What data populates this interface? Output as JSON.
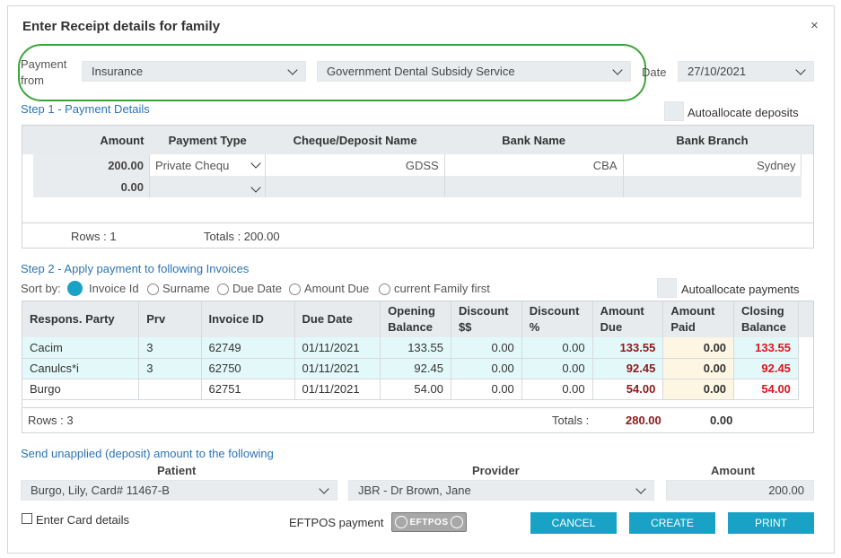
{
  "dialog": {
    "title": "Enter Receipt details for family",
    "close_icon": "×"
  },
  "payment_from": {
    "label_line1": "Payment",
    "label_line2": "from",
    "type_value": "Insurance",
    "provider_value": "Government Dental Subsidy Service"
  },
  "date": {
    "label": "Date",
    "value": "27/10/2021"
  },
  "step1": {
    "title": "Step 1 - Payment Details",
    "autoallocate_label": "Autoallocate deposits",
    "columns": [
      "Amount",
      "Payment Type",
      "Cheque/Deposit Name",
      "Bank Name",
      "Bank Branch"
    ],
    "row1": {
      "amount": "200.00",
      "type": "Private Chequ",
      "name": "GDSS",
      "bank": "CBA",
      "branch": "Sydney"
    },
    "row2": {
      "amount": "0.00"
    },
    "rows_label": "Rows : 1",
    "totals_label": "Totals : 200.00"
  },
  "step2": {
    "title": "Step 2 - Apply payment to following Invoices",
    "sort_by": "Sort by:",
    "sort_options": [
      "Invoice Id",
      "Surname",
      "Due Date",
      "Amount Due",
      "current Family first"
    ],
    "autoallocate_label": "Autoallocate payments",
    "columns": [
      "Respons. Party",
      "Prv",
      "Invoice ID",
      "Due Date",
      "Opening Balance",
      "Discount $$",
      "Discount %",
      "Amount Due",
      "Amount Paid",
      "Closing Balance"
    ],
    "rows": [
      {
        "party": "Cacim",
        "prv": "3",
        "invoice": "62749",
        "due_date": "01/11/2021",
        "opening": "133.55",
        "disc_d": "0.00",
        "disc_p": "0.00",
        "amount_due": "133.55",
        "paid": "0.00",
        "closing": "133.55"
      },
      {
        "party": "Canulcs*i",
        "prv": "3",
        "invoice": "62750",
        "due_date": "01/11/2021",
        "opening": "92.45",
        "disc_d": "0.00",
        "disc_p": "0.00",
        "amount_due": "92.45",
        "paid": "0.00",
        "closing": "92.45"
      },
      {
        "party": "Burgo",
        "prv": "",
        "invoice": "62751",
        "due_date": "01/11/2021",
        "opening": "54.00",
        "disc_d": "0.00",
        "disc_p": "0.00",
        "amount_due": "54.00",
        "paid": "0.00",
        "closing": "54.00"
      }
    ],
    "rows_label": "Rows : 3",
    "totals_label": "Totals :",
    "total_due": "280.00",
    "total_paid": "0.00"
  },
  "deposit": {
    "title": "Send unapplied (deposit) amount to the following",
    "patient_label": "Patient",
    "patient_value": "Burgo, Lily, Card# 11467-B",
    "provider_label": "Provider",
    "provider_value": "JBR - Dr Brown, Jane",
    "amount_label": "Amount",
    "amount_value": "200.00"
  },
  "footer": {
    "card_label": "Enter Card details",
    "eftpos_label": "EFTPOS payment",
    "eftpos_logo": "EFTPOS",
    "cancel": "CANCEL",
    "create": "CREATE",
    "print": "PRINT"
  },
  "colors": {
    "accent": "#17a2c6",
    "link_blue": "#2e74b5",
    "highlight": "#3aa53a",
    "due": "#8b1a1a",
    "closing": "#e0141e"
  }
}
